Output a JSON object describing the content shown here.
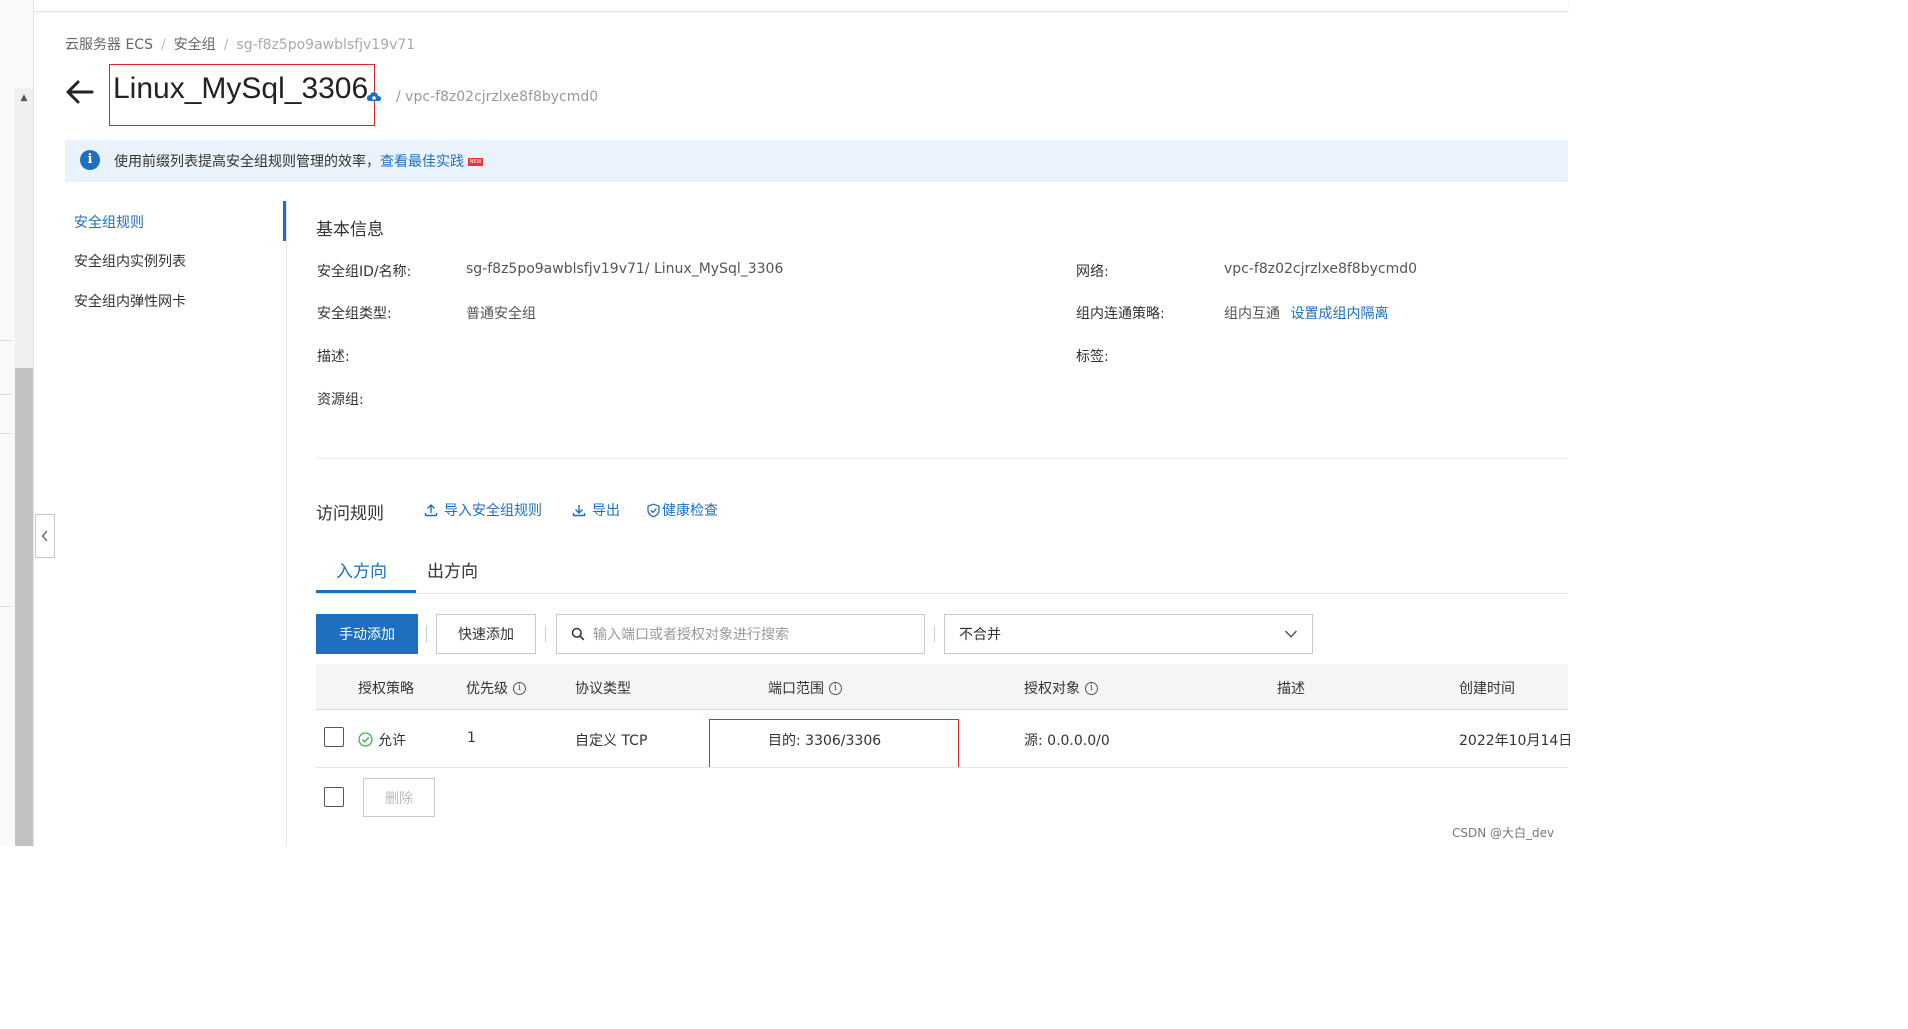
{
  "breadcrumb": {
    "items": [
      "云服务器 ECS",
      "安全组",
      "sg-f8z5po9awblsfjv19v71"
    ],
    "separator": "/"
  },
  "header": {
    "title": "Linux_MySql_3306",
    "vpc": "/ vpc-f8z02cjrzlxe8f8bycmd0",
    "icons": [
      "back-arrow-icon",
      "cloud-sync-icon"
    ]
  },
  "banner": {
    "text": "使用前缀列表提高安全组规则管理的效率，",
    "link": "查看最佳实践",
    "badge": "NEW"
  },
  "sidebar": {
    "items": [
      {
        "label": "安全组规则",
        "active": true
      },
      {
        "label": "安全组内实例列表",
        "active": false
      },
      {
        "label": "安全组内弹性网卡",
        "active": false
      }
    ]
  },
  "basic_info": {
    "title": "基本信息",
    "id_name_label": "安全组ID/名称:",
    "id_name_value": "sg-f8z5po9awblsfjv19v71/ Linux_MySql_3306",
    "network_label": "网络:",
    "network_value": "vpc-f8z02cjrzlxe8f8bycmd0",
    "type_label": "安全组类型:",
    "type_value": "普通安全组",
    "policy_label": "组内连通策略:",
    "policy_value": "组内互通",
    "policy_link": "设置成组内隔离",
    "desc_label": "描述:",
    "tags_label": "标签:",
    "rg_label": "资源组:"
  },
  "access_rules": {
    "title": "访问规则",
    "actions": [
      "导入安全组规则",
      "导出",
      "健康检查"
    ]
  },
  "tabs": [
    {
      "label": "入方向",
      "active": true
    },
    {
      "label": "出方向",
      "active": false
    }
  ],
  "toolbar": {
    "manual_add": "手动添加",
    "quick_add": "快速添加",
    "search_placeholder": "输入端口或者授权对象进行搜索",
    "select_value": "不合并"
  },
  "table": {
    "headers": [
      "授权策略",
      "优先级",
      "协议类型",
      "端口范围",
      "授权对象",
      "描述",
      "创建时间"
    ],
    "rows": [
      {
        "policy": "允许",
        "priority": "1",
        "protocol": "自定义 TCP",
        "port": "目的: 3306/3306",
        "target": "源: 0.0.0.0/0",
        "desc": "",
        "created": "2022年10月14日"
      }
    ],
    "delete_label": "删除"
  },
  "watermark": "CSDN @大白_dev",
  "colors": {
    "accent": "#1e6fc0",
    "highlight_box": "#e0252a",
    "success": "#3bb54a",
    "banner_bg": "#eaf2fb"
  }
}
